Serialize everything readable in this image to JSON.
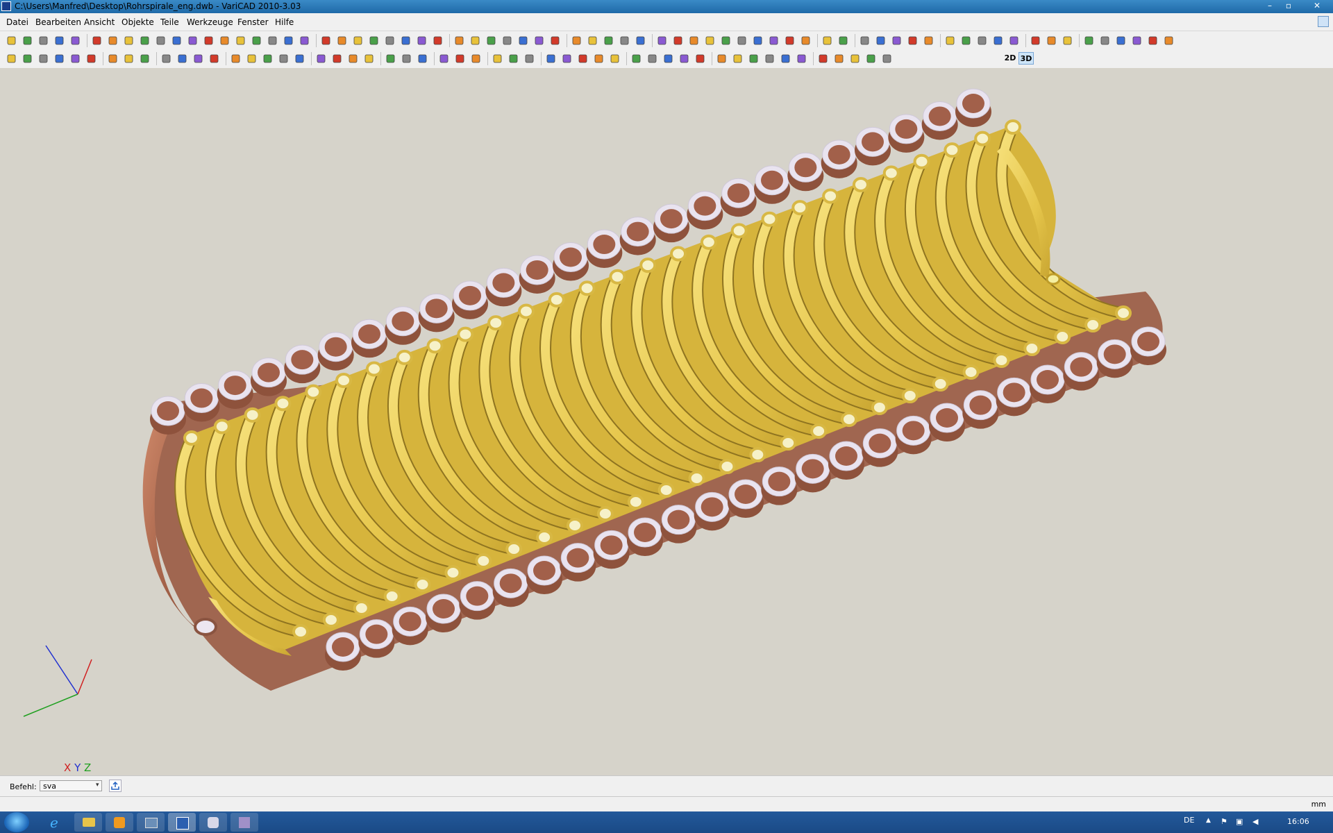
{
  "window": {
    "title": "C:\\Users\\Manfred\\Desktop\\Rohrspirale_eng.dwb - VariCAD 2010-3.03",
    "min_symbol": "–",
    "max_symbol": "▫",
    "close_symbol": "✕"
  },
  "menu": {
    "file": "Datei",
    "edit": "Bearbeiten",
    "view": "Ansicht",
    "objects": "Objekte",
    "parts": "Teile",
    "tools": "Werkzeuge",
    "window": "Fenster",
    "help": "Hilfe"
  },
  "toolbar": {
    "mode_2d": "2D",
    "mode_3d": "3D"
  },
  "viewport": {
    "background": "#d6d3ca",
    "outer_coil_color": "#b8735a",
    "inner_coil_color": "#ead05c",
    "tube_end_color": "#e8e2ee",
    "axis_x_label": "X",
    "axis_y_label": "Y",
    "axis_z_label": "Z"
  },
  "command": {
    "label": "Befehl:",
    "value": "sva"
  },
  "status": {
    "units": "mm"
  },
  "taskbar": {
    "language": "DE",
    "clock": "16:06"
  }
}
